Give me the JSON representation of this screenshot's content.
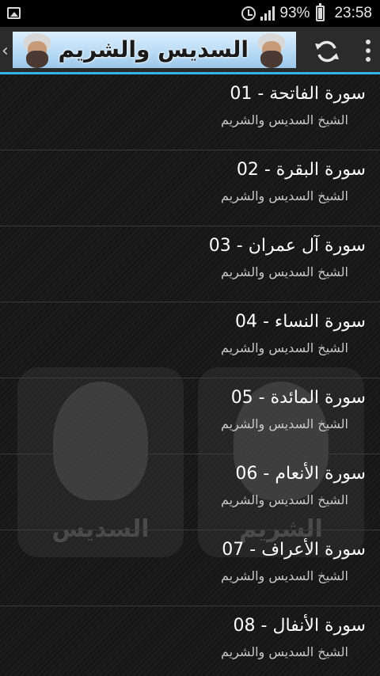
{
  "status_bar": {
    "battery_text": "93%",
    "time": "23:58",
    "icons": [
      "image-icon",
      "alarm-icon",
      "signal-icon",
      "battery-icon"
    ]
  },
  "action_bar": {
    "banner_title": "السديس والشريم",
    "icons": [
      "back-chevron-icon",
      "refresh-icon",
      "overflow-menu-icon"
    ],
    "accent_color": "#33b5e5"
  },
  "watermarks": {
    "left_label": "السديس",
    "right_label": "الشريم"
  },
  "items": [
    {
      "title": "01 - سورة الفاتحة",
      "subtitle": "الشيخ السديس والشريم"
    },
    {
      "title": "02 - سورة البقرة",
      "subtitle": "الشيخ السديس والشريم"
    },
    {
      "title": "03 - سورة آل عمران",
      "subtitle": "الشيخ السديس والشريم"
    },
    {
      "title": "04 - سورة النساء",
      "subtitle": "الشيخ السديس والشريم"
    },
    {
      "title": "05 - سورة المائدة",
      "subtitle": "الشيخ السديس والشريم"
    },
    {
      "title": "06 - سورة الأنعام",
      "subtitle": "الشيخ السديس والشريم"
    },
    {
      "title": "07 - سورة الأعراف",
      "subtitle": "الشيخ السديس والشريم"
    },
    {
      "title": "08 - سورة الأنفال",
      "subtitle": "الشيخ السديس والشريم"
    }
  ]
}
